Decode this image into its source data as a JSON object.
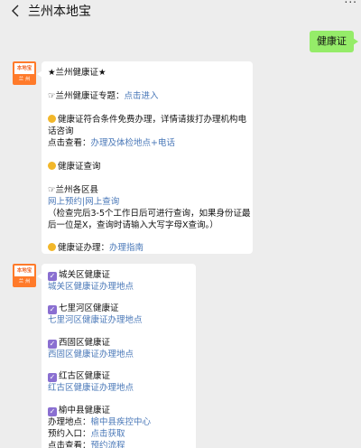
{
  "header": {
    "title": "兰州本地宝",
    "more": "..."
  },
  "user_message": "健康证",
  "avatar": {
    "top_text": "本地宝",
    "bottom_text": "兰 州"
  },
  "msg1": {
    "title": "★兰州健康证★",
    "topic_prefix": "☞兰州健康证专题：",
    "topic_link": "点击进入",
    "free_line1": "健康证符合条件免费办理，详情请拨打办理机构电",
    "free_line2": "话咨询",
    "view_prefix": "点击查看：",
    "view_link": "办理及体检地点+电话",
    "query_title": "健康证查询",
    "county_title": "☞兰州各区县",
    "county_link1": "网上预约",
    "county_sep": "|",
    "county_link2": "网上查询",
    "note_line1": "（检查完后3-5个工作日后可进行查询，如果身份证最",
    "note_line2": "后一位是X，查询时请输入大写字母X查询。）",
    "handle_prefix": "健康证办理：",
    "handle_link": "办理指南"
  },
  "msg2": {
    "districts": [
      {
        "title": "城关区健康证",
        "link": "城关区健康证办理地点"
      },
      {
        "title": "七里河区健康证",
        "link": "七里河区健康证办理地点"
      },
      {
        "title": "西固区健康证",
        "link": "西固区健康证办理地点"
      },
      {
        "title": "红古区健康证",
        "link": "红古区健康证办理地点"
      }
    ],
    "yuzhong_title": "榆中县健康证",
    "yuzhong_addr_prefix": "办理地点：",
    "yuzhong_addr_link": "榆中县疾控中心",
    "yuzhong_book_prefix": "预约入口：",
    "yuzhong_book_link": "点击获取",
    "yuzhong_view_prefix": "点击查看：",
    "yuzhong_view_link": "预约流程"
  },
  "colors": {
    "user_bubble": "#95ec69",
    "link": "#4a78b8",
    "avatar": "#ff7a2a",
    "bullet": "#f2b72a",
    "check": "#8a6fd1"
  }
}
